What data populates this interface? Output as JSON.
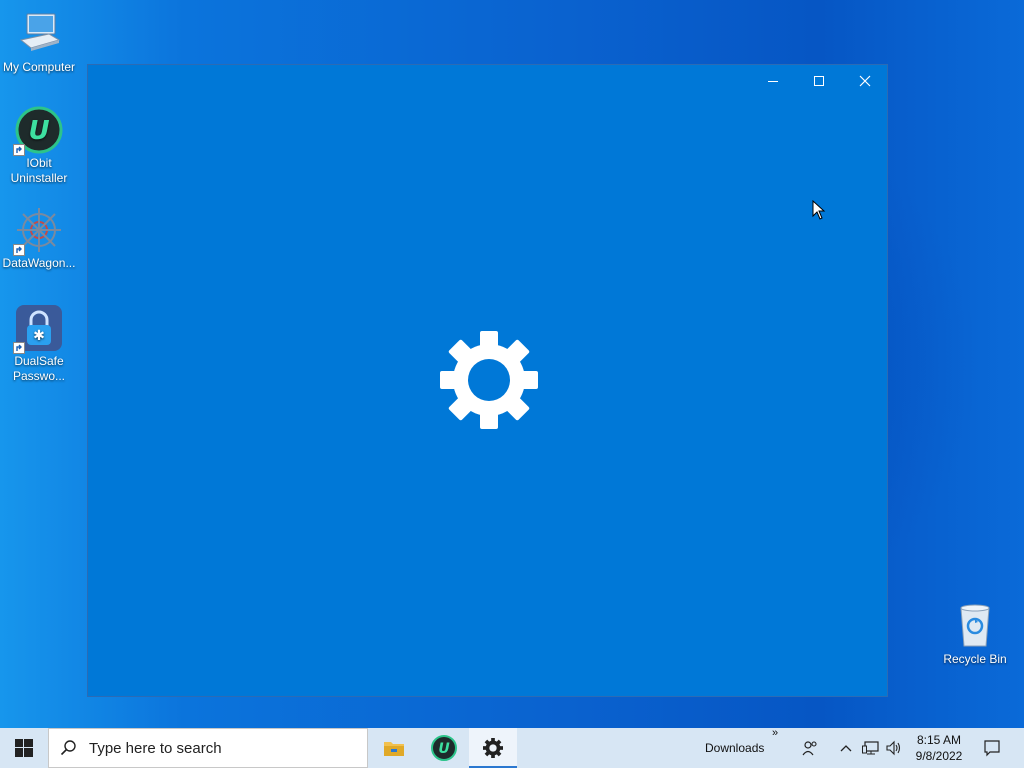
{
  "desktop": {
    "icons": [
      {
        "label": "My Computer"
      },
      {
        "label": "IObit Uninstaller"
      },
      {
        "label": "DataWagon..."
      },
      {
        "label": "DualSafe Passwo..."
      },
      {
        "label": "Recycle Bin"
      }
    ]
  },
  "window": {
    "minimize_icon": "minimize-icon",
    "maximize_icon": "maximize-icon",
    "close_icon": "close-icon",
    "splash_icon": "gear-icon",
    "background_color": "#0078d7"
  },
  "taskbar": {
    "search_placeholder": "Type here to search",
    "apps": [
      {
        "name": "file-explorer-icon"
      },
      {
        "name": "iobit-uninstaller-icon"
      },
      {
        "name": "settings-gear-icon",
        "active": true
      }
    ],
    "toolbar_label": "Downloads",
    "toolbar_chevron": "»",
    "time": "8:15 AM",
    "date": "9/8/2022"
  }
}
